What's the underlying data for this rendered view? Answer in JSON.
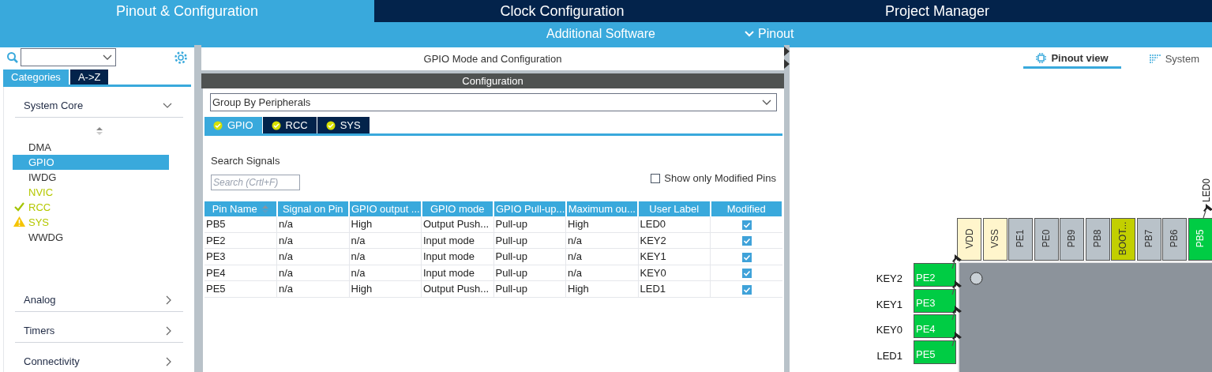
{
  "main_tabs": [
    {
      "label": "Pinout & Configuration",
      "selected": true
    },
    {
      "label": "Clock Configuration",
      "selected": false
    },
    {
      "label": "Project Manager",
      "selected": false
    }
  ],
  "sub_bar": {
    "additional_software": "Additional Software",
    "pinout_menu": "Pinout"
  },
  "sidebar": {
    "tabs": [
      {
        "label": "Categories",
        "selected": true
      },
      {
        "label": "A->Z",
        "selected": false
      }
    ],
    "categories": [
      {
        "label": "System Core",
        "expanded": true,
        "items": [
          {
            "label": "DMA",
            "kind": "off",
            "selected": false
          },
          {
            "label": "GPIO",
            "kind": "off",
            "selected": true
          },
          {
            "label": "IWDG",
            "kind": "off",
            "selected": false
          },
          {
            "label": "NVIC",
            "kind": "on",
            "selected": false
          },
          {
            "label": "RCC",
            "kind": "ok",
            "selected": false
          },
          {
            "label": "SYS",
            "kind": "warning",
            "selected": false
          },
          {
            "label": "WWDG",
            "kind": "off",
            "selected": false
          }
        ]
      },
      {
        "label": "Analog",
        "expanded": false
      },
      {
        "label": "Timers",
        "expanded": false
      },
      {
        "label": "Connectivity",
        "expanded": false
      }
    ]
  },
  "config_panel": {
    "title": "GPIO Mode and Configuration",
    "header": "Configuration",
    "group_select": "Group By Peripherals",
    "tabs": [
      {
        "label": "GPIO",
        "selected": true
      },
      {
        "label": "RCC",
        "selected": false
      },
      {
        "label": "SYS",
        "selected": false
      }
    ],
    "search_label": "Search Signals",
    "search_placeholder": "Search (Crtl+F)",
    "show_modified": {
      "label": "Show only Modified Pins",
      "checked": false
    },
    "table": {
      "columns": [
        "Pin Name",
        "Signal on Pin",
        "GPIO output ...",
        "GPIO mode",
        "GPIO Pull-up...",
        "Maximum ou...",
        "User Label",
        "Modified"
      ],
      "rows": [
        {
          "cells": [
            "PB5",
            "n/a",
            "High",
            "Output Push...",
            "Pull-up",
            "High",
            "LED0"
          ],
          "modified": true
        },
        {
          "cells": [
            "PE2",
            "n/a",
            "n/a",
            "Input mode",
            "Pull-up",
            "n/a",
            "KEY2"
          ],
          "modified": true
        },
        {
          "cells": [
            "PE3",
            "n/a",
            "n/a",
            "Input mode",
            "Pull-up",
            "n/a",
            "KEY1"
          ],
          "modified": true
        },
        {
          "cells": [
            "PE4",
            "n/a",
            "n/a",
            "Input mode",
            "Pull-up",
            "n/a",
            "KEY0"
          ],
          "modified": true
        },
        {
          "cells": [
            "PE5",
            "n/a",
            "High",
            "Output Push...",
            "Pull-up",
            "High",
            "LED1"
          ],
          "modified": true
        }
      ]
    }
  },
  "view_tabs": [
    {
      "label": "Pinout view",
      "selected": true
    },
    {
      "label": "System",
      "selected": false
    }
  ],
  "chip": {
    "top_pins": [
      {
        "name": "VDD",
        "kind": "power"
      },
      {
        "name": "VSS",
        "kind": "power"
      },
      {
        "name": "PE1",
        "kind": "free"
      },
      {
        "name": "PE0",
        "kind": "free"
      },
      {
        "name": "PB9",
        "kind": "free"
      },
      {
        "name": "PB8",
        "kind": "free"
      },
      {
        "name": "BOOT...",
        "kind": "boot"
      },
      {
        "name": "PB7",
        "kind": "free"
      },
      {
        "name": "PB6",
        "kind": "free"
      },
      {
        "name": "PB5",
        "kind": "assigned",
        "label": "LED0"
      }
    ],
    "left_pins": [
      {
        "name": "PE2",
        "kind": "assigned",
        "label": "KEY2"
      },
      {
        "name": "PE3",
        "kind": "assigned",
        "label": "KEY1"
      },
      {
        "name": "PE4",
        "kind": "assigned",
        "label": "KEY0"
      },
      {
        "name": "PE5",
        "kind": "assigned",
        "label": "LED1"
      }
    ]
  }
}
